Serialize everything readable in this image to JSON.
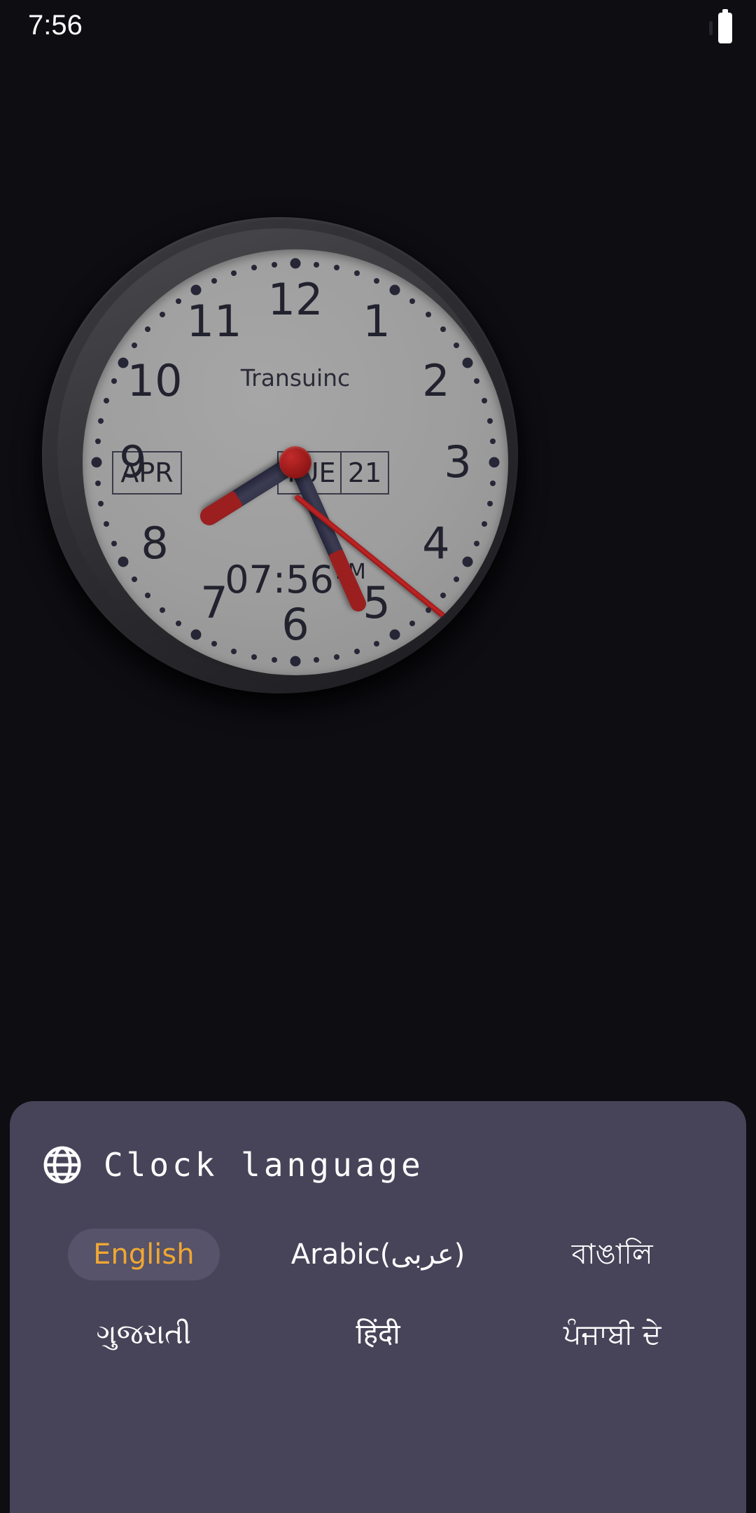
{
  "status_bar": {
    "time": "7:56",
    "battery_icon": "battery-full-icon"
  },
  "clock": {
    "brand": "Transuinc",
    "month_window": "APR",
    "day_window": "TUE",
    "date_window": "21",
    "digital_time": "07:56",
    "digital_ampm": "PM",
    "numerals": [
      "12",
      "1",
      "2",
      "3",
      "4",
      "5",
      "6",
      "7",
      "8",
      "9",
      "10",
      "11"
    ],
    "hands": {
      "hour_angle_deg": 238,
      "minute_angle_deg": 156,
      "second_angle_deg": 129
    },
    "colors": {
      "face": "#9d9d9d",
      "bezel": "#2e2e32",
      "numeral": "#22222f",
      "hand_dark": "#34344a",
      "hand_red": "#9b1f1f",
      "cap": "#a81e1e"
    }
  },
  "sheet": {
    "icon": "globe-icon",
    "title": "Clock language",
    "background_color": "#474459",
    "selected_chip_bg": "#56536a",
    "selected_chip_text": "#f0a732",
    "languages": [
      {
        "label": "English",
        "selected": true
      },
      {
        "label": "Arabic(عربى)",
        "selected": false
      },
      {
        "label": "বাঙালি",
        "selected": false
      },
      {
        "label": "ગુજરાતી",
        "selected": false
      },
      {
        "label": "हिंदी",
        "selected": false
      },
      {
        "label": "ਪੰਜਾਬੀ ਦੇ",
        "selected": false
      }
    ]
  }
}
